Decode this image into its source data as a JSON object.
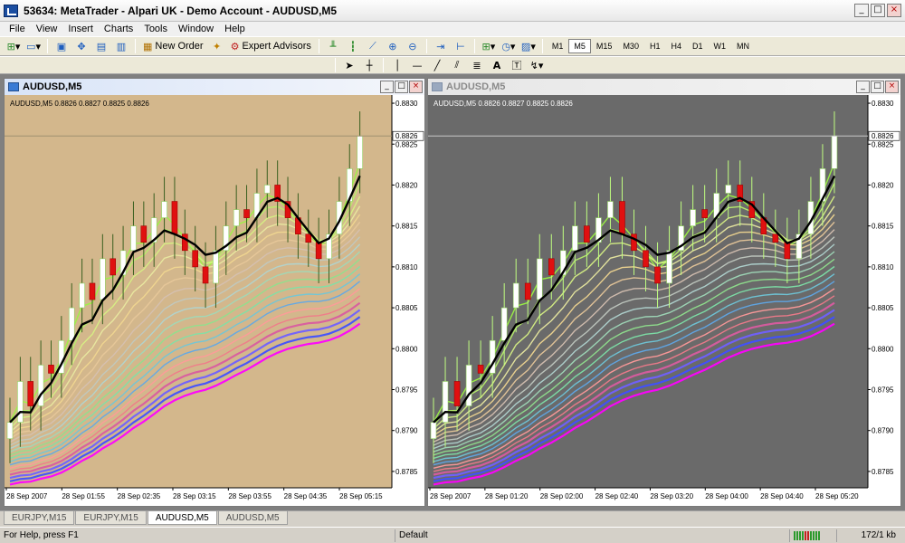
{
  "window": {
    "title": "53634: MetaTrader - Alpari UK - Demo Account - AUDUSD,M5"
  },
  "menu": [
    "File",
    "View",
    "Insert",
    "Charts",
    "Tools",
    "Window",
    "Help"
  ],
  "toolbar": {
    "new_order": "New Order",
    "expert_advisors": "Expert Advisors",
    "timeframes": [
      "M1",
      "M5",
      "M15",
      "M30",
      "H1",
      "H4",
      "D1",
      "W1",
      "MN"
    ],
    "active_timeframe": "M5"
  },
  "tabs": [
    {
      "label": "EURJPY,M15",
      "active": false
    },
    {
      "label": "EURJPY,M15",
      "active": false
    },
    {
      "label": "AUDUSD,M5",
      "active": true
    },
    {
      "label": "AUDUSD,M5",
      "active": false
    }
  ],
  "status": {
    "help": "For Help, press F1",
    "profile": "Default",
    "traffic": "172/1 kb"
  },
  "colors": {
    "left_bg": "#d3b78c",
    "right_bg": "#6a6a6a",
    "ribbon_base": "#ff00ff"
  },
  "charts": [
    {
      "id": "left",
      "title": "AUDUSD,M5",
      "info": "AUDUSD,M5  0.8826 0.8827 0.8825 0.8826",
      "price_labels": [
        "0.8830",
        "0.8825",
        "0.8820",
        "0.8815",
        "0.8810",
        "0.8805",
        "0.8800",
        "0.8795",
        "0.8790",
        "0.8785"
      ],
      "current_price": "0.8826",
      "time_labels": [
        "28 Sep 2007",
        "28 Sep 01:55",
        "28 Sep 02:35",
        "28 Sep 03:15",
        "28 Sep 03:55",
        "28 Sep 04:35",
        "28 Sep 05:15"
      ]
    },
    {
      "id": "right",
      "title": "AUDUSD,M5",
      "info": "AUDUSD,M5  0.8826 0.8827 0.8825 0.8826",
      "price_labels": [
        "0.8830",
        "0.8825",
        "0.8820",
        "0.8815",
        "0.8810",
        "0.8805",
        "0.8800",
        "0.8795",
        "0.8790",
        "0.8785"
      ],
      "current_price": "0.8826",
      "time_labels": [
        "28 Sep 2007",
        "28 Sep 01:20",
        "28 Sep 02:00",
        "28 Sep 02:40",
        "28 Sep 03:20",
        "28 Sep 04:00",
        "28 Sep 04:40",
        "28 Sep 05:20"
      ]
    }
  ],
  "price_series": [
    0.8791,
    0.8796,
    0.8793,
    0.8798,
    0.8797,
    0.8801,
    0.8805,
    0.8808,
    0.8806,
    0.8811,
    0.8809,
    0.8812,
    0.8815,
    0.8813,
    0.8816,
    0.8818,
    0.8814,
    0.8812,
    0.881,
    0.8808,
    0.8812,
    0.8815,
    0.8817,
    0.8816,
    0.8819,
    0.882,
    0.8818,
    0.8816,
    0.8814,
    0.8813,
    0.8811,
    0.8814,
    0.8818,
    0.8822,
    0.8826
  ]
}
